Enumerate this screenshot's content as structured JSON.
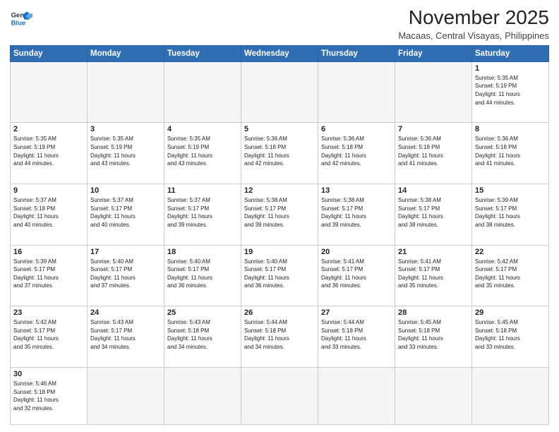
{
  "header": {
    "logo_general": "General",
    "logo_blue": "Blue",
    "month_title": "November 2025",
    "location": "Macaas, Central Visayas, Philippines"
  },
  "weekdays": [
    "Sunday",
    "Monday",
    "Tuesday",
    "Wednesday",
    "Thursday",
    "Friday",
    "Saturday"
  ],
  "weeks": [
    [
      {
        "day": "",
        "info": ""
      },
      {
        "day": "",
        "info": ""
      },
      {
        "day": "",
        "info": ""
      },
      {
        "day": "",
        "info": ""
      },
      {
        "day": "",
        "info": ""
      },
      {
        "day": "",
        "info": ""
      },
      {
        "day": "1",
        "info": "Sunrise: 5:35 AM\nSunset: 5:19 PM\nDaylight: 11 hours\nand 44 minutes."
      }
    ],
    [
      {
        "day": "2",
        "info": "Sunrise: 5:35 AM\nSunset: 5:19 PM\nDaylight: 11 hours\nand 44 minutes."
      },
      {
        "day": "3",
        "info": "Sunrise: 5:35 AM\nSunset: 5:19 PM\nDaylight: 11 hours\nand 43 minutes."
      },
      {
        "day": "4",
        "info": "Sunrise: 5:35 AM\nSunset: 5:19 PM\nDaylight: 11 hours\nand 43 minutes."
      },
      {
        "day": "5",
        "info": "Sunrise: 5:36 AM\nSunset: 5:18 PM\nDaylight: 11 hours\nand 42 minutes."
      },
      {
        "day": "6",
        "info": "Sunrise: 5:36 AM\nSunset: 5:18 PM\nDaylight: 11 hours\nand 42 minutes."
      },
      {
        "day": "7",
        "info": "Sunrise: 5:36 AM\nSunset: 5:18 PM\nDaylight: 11 hours\nand 41 minutes."
      },
      {
        "day": "8",
        "info": "Sunrise: 5:36 AM\nSunset: 5:18 PM\nDaylight: 11 hours\nand 41 minutes."
      }
    ],
    [
      {
        "day": "9",
        "info": "Sunrise: 5:37 AM\nSunset: 5:18 PM\nDaylight: 11 hours\nand 40 minutes."
      },
      {
        "day": "10",
        "info": "Sunrise: 5:37 AM\nSunset: 5:17 PM\nDaylight: 11 hours\nand 40 minutes."
      },
      {
        "day": "11",
        "info": "Sunrise: 5:37 AM\nSunset: 5:17 PM\nDaylight: 11 hours\nand 39 minutes."
      },
      {
        "day": "12",
        "info": "Sunrise: 5:38 AM\nSunset: 5:17 PM\nDaylight: 11 hours\nand 39 minutes."
      },
      {
        "day": "13",
        "info": "Sunrise: 5:38 AM\nSunset: 5:17 PM\nDaylight: 11 hours\nand 39 minutes."
      },
      {
        "day": "14",
        "info": "Sunrise: 5:38 AM\nSunset: 5:17 PM\nDaylight: 11 hours\nand 38 minutes."
      },
      {
        "day": "15",
        "info": "Sunrise: 5:39 AM\nSunset: 5:17 PM\nDaylight: 11 hours\nand 38 minutes."
      }
    ],
    [
      {
        "day": "16",
        "info": "Sunrise: 5:39 AM\nSunset: 5:17 PM\nDaylight: 11 hours\nand 37 minutes."
      },
      {
        "day": "17",
        "info": "Sunrise: 5:40 AM\nSunset: 5:17 PM\nDaylight: 11 hours\nand 37 minutes."
      },
      {
        "day": "18",
        "info": "Sunrise: 5:40 AM\nSunset: 5:17 PM\nDaylight: 11 hours\nand 36 minutes."
      },
      {
        "day": "19",
        "info": "Sunrise: 5:40 AM\nSunset: 5:17 PM\nDaylight: 11 hours\nand 36 minutes."
      },
      {
        "day": "20",
        "info": "Sunrise: 5:41 AM\nSunset: 5:17 PM\nDaylight: 11 hours\nand 36 minutes."
      },
      {
        "day": "21",
        "info": "Sunrise: 5:41 AM\nSunset: 5:17 PM\nDaylight: 11 hours\nand 35 minutes."
      },
      {
        "day": "22",
        "info": "Sunrise: 5:42 AM\nSunset: 5:17 PM\nDaylight: 11 hours\nand 35 minutes."
      }
    ],
    [
      {
        "day": "23",
        "info": "Sunrise: 5:42 AM\nSunset: 5:17 PM\nDaylight: 11 hours\nand 35 minutes."
      },
      {
        "day": "24",
        "info": "Sunrise: 5:43 AM\nSunset: 5:17 PM\nDaylight: 11 hours\nand 34 minutes."
      },
      {
        "day": "25",
        "info": "Sunrise: 5:43 AM\nSunset: 5:18 PM\nDaylight: 11 hours\nand 34 minutes."
      },
      {
        "day": "26",
        "info": "Sunrise: 5:44 AM\nSunset: 5:18 PM\nDaylight: 11 hours\nand 34 minutes."
      },
      {
        "day": "27",
        "info": "Sunrise: 5:44 AM\nSunset: 5:18 PM\nDaylight: 11 hours\nand 33 minutes."
      },
      {
        "day": "28",
        "info": "Sunrise: 5:45 AM\nSunset: 5:18 PM\nDaylight: 11 hours\nand 33 minutes."
      },
      {
        "day": "29",
        "info": "Sunrise: 5:45 AM\nSunset: 5:18 PM\nDaylight: 11 hours\nand 33 minutes."
      }
    ],
    [
      {
        "day": "30",
        "info": "Sunrise: 5:46 AM\nSunset: 5:18 PM\nDaylight: 11 hours\nand 32 minutes."
      },
      {
        "day": "",
        "info": ""
      },
      {
        "day": "",
        "info": ""
      },
      {
        "day": "",
        "info": ""
      },
      {
        "day": "",
        "info": ""
      },
      {
        "day": "",
        "info": ""
      },
      {
        "day": "",
        "info": ""
      }
    ]
  ]
}
